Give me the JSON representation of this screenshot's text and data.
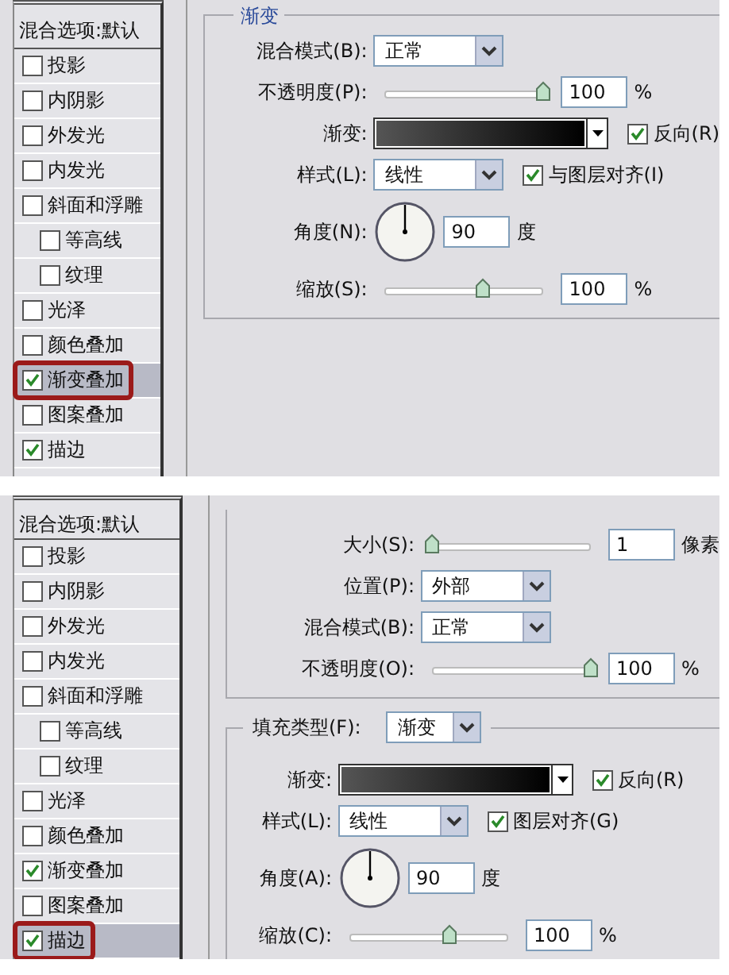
{
  "panels": [
    {
      "sidebar": {
        "header": "混合选项:默认",
        "items": [
          {
            "label": "投影",
            "checked": false,
            "selected": false
          },
          {
            "label": "内阴影",
            "checked": false,
            "selected": false
          },
          {
            "label": "外发光",
            "checked": false,
            "selected": false
          },
          {
            "label": "内发光",
            "checked": false,
            "selected": false
          },
          {
            "label": "斜面和浮雕",
            "checked": false,
            "selected": false,
            "children": [
              {
                "label": "等高线",
                "checked": false,
                "selected": false
              },
              {
                "label": "纹理",
                "checked": false,
                "selected": false
              }
            ]
          },
          {
            "label": "光泽",
            "checked": false,
            "selected": false
          },
          {
            "label": "颜色叠加",
            "checked": false,
            "selected": false
          },
          {
            "label": "渐变叠加",
            "checked": true,
            "selected": true
          },
          {
            "label": "图案叠加",
            "checked": false,
            "selected": false
          },
          {
            "label": "描边",
            "checked": true,
            "selected": false
          }
        ]
      },
      "sections": [
        {
          "legend": "渐变",
          "rows": [
            {
              "kind": "select",
              "label": "混合模式(B):",
              "value": "正常"
            },
            {
              "kind": "slider",
              "label": "不透明度(P):",
              "level": 1,
              "value": "100",
              "unit": "%"
            },
            {
              "kind": "gradient",
              "label": "渐变:",
              "checkbox": {
                "label": "反向(R)",
                "checked": true
              }
            },
            {
              "kind": "select",
              "label": "样式(L):",
              "value": "线性",
              "checkbox": {
                "label": "与图层对齐(I)",
                "checked": true
              }
            },
            {
              "kind": "angle",
              "label": "角度(N):",
              "value": "90",
              "unit": "度"
            },
            {
              "kind": "slider",
              "label": "缩放(S):",
              "level": 0.62,
              "value": "100",
              "unit": "%"
            }
          ]
        }
      ]
    },
    {
      "sidebar": {
        "header": "混合选项:默认",
        "items": [
          {
            "label": "投影",
            "checked": false,
            "selected": false
          },
          {
            "label": "内阴影",
            "checked": false,
            "selected": false
          },
          {
            "label": "外发光",
            "checked": false,
            "selected": false
          },
          {
            "label": "内发光",
            "checked": false,
            "selected": false
          },
          {
            "label": "斜面和浮雕",
            "checked": false,
            "selected": false,
            "children": [
              {
                "label": "等高线",
                "checked": false,
                "selected": false
              },
              {
                "label": "纹理",
                "checked": false,
                "selected": false
              }
            ]
          },
          {
            "label": "光泽",
            "checked": false,
            "selected": false
          },
          {
            "label": "颜色叠加",
            "checked": false,
            "selected": false
          },
          {
            "label": "渐变叠加",
            "checked": true,
            "selected": false
          },
          {
            "label": "图案叠加",
            "checked": false,
            "selected": false
          },
          {
            "label": "描边",
            "checked": true,
            "selected": true
          }
        ]
      },
      "sections": [
        {
          "rows": [
            {
              "kind": "slider",
              "label": "大小(S):",
              "level": 0,
              "value": "1",
              "unit": "像素"
            },
            {
              "kind": "select",
              "label": "位置(P):",
              "value": "外部"
            },
            {
              "kind": "select",
              "label": "混合模式(B):",
              "value": "正常"
            },
            {
              "kind": "slider",
              "label": "不透明度(O):",
              "level": 1,
              "value": "100",
              "unit": "%"
            }
          ]
        },
        {
          "legend_select": {
            "label": "填充类型(F):",
            "value": "渐变"
          },
          "rows": [
            {
              "kind": "gradient",
              "label": "渐变:",
              "checkbox": {
                "label": "反向(R)",
                "checked": true
              }
            },
            {
              "kind": "select",
              "label": "样式(L):",
              "value": "线性",
              "checkbox": {
                "label": "图层对齐(G)",
                "checked": true
              }
            },
            {
              "kind": "angle",
              "label": "角度(A):",
              "value": "90",
              "unit": "度"
            },
            {
              "kind": "slider",
              "label": "缩放(C):",
              "level": 0.63,
              "value": "100",
              "unit": "%"
            }
          ]
        }
      ]
    }
  ]
}
